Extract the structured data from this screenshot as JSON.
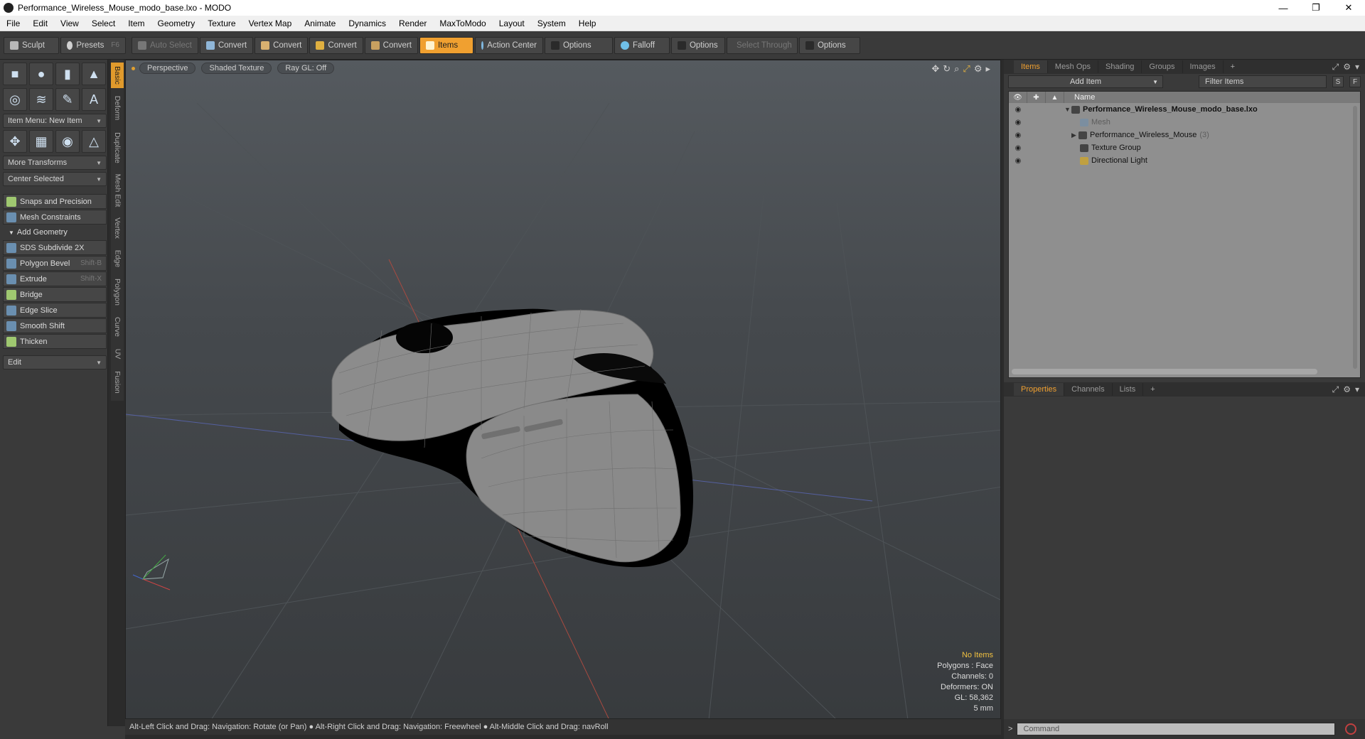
{
  "window": {
    "title": "Performance_Wireless_Mouse_modo_base.lxo - MODO",
    "minimize": "—",
    "maximize": "❐",
    "close": "✕"
  },
  "menu": [
    "File",
    "Edit",
    "View",
    "Select",
    "Item",
    "Geometry",
    "Texture",
    "Vertex Map",
    "Animate",
    "Dynamics",
    "Render",
    "MaxToModo",
    "Layout",
    "System",
    "Help"
  ],
  "toolbar": {
    "sculpt": "Sculpt",
    "presets": "Presets",
    "presets_shortcut": "F6",
    "auto_select": "Auto Select",
    "convert1": "Convert",
    "convert2": "Convert",
    "convert3": "Convert",
    "convert4": "Convert",
    "items": "Items",
    "action_center": "Action Center",
    "options1": "Options",
    "falloff": "Falloff",
    "options2": "Options",
    "select_through": "Select Through",
    "options3": "Options"
  },
  "left_panel": {
    "item_menu": "Item Menu: New Item",
    "more_transforms": "More Transforms",
    "center_selected": "Center Selected",
    "snaps": "Snaps and Precision",
    "mesh_constraints": "Mesh Constraints",
    "add_geometry": "Add Geometry",
    "tools": [
      {
        "label": "SDS Subdivide 2X",
        "shortcut": ""
      },
      {
        "label": "Polygon Bevel",
        "shortcut": "Shift-B"
      },
      {
        "label": "Extrude",
        "shortcut": "Shift-X"
      },
      {
        "label": "Bridge",
        "shortcut": ""
      },
      {
        "label": "Edge Slice",
        "shortcut": ""
      },
      {
        "label": "Smooth Shift",
        "shortcut": ""
      },
      {
        "label": "Thicken",
        "shortcut": ""
      }
    ],
    "edit": "Edit"
  },
  "vertical_tabs": [
    "Basic",
    "Deform",
    "Duplicate",
    "Mesh Edit",
    "Vertex",
    "Edge",
    "Polygon",
    "Curve",
    "UV",
    "Fusion"
  ],
  "viewport": {
    "view": "Perspective",
    "shading": "Shaded Texture",
    "raygl": "Ray GL: Off",
    "info": {
      "items": "No Items",
      "polygons": "Polygons : Face",
      "channels": "Channels: 0",
      "deformers": "Deformers: ON",
      "gl": "GL: 58,362",
      "scale": "5 mm"
    }
  },
  "status": "Alt-Left Click and Drag: Navigation: Rotate (or Pan) ● Alt-Right Click and Drag: Navigation: Freewheel ● Alt-Middle Click and Drag: navRoll",
  "right_panel": {
    "tabs": [
      "Items",
      "Mesh Ops",
      "Shading",
      "Groups",
      "Images"
    ],
    "add_item": "Add Item",
    "filter": "Filter Items",
    "s_btn": "S",
    "f_btn": "F",
    "name_col": "Name",
    "tree": [
      {
        "label": "Performance_Wireless_Mouse_modo_base.lxo",
        "count": ""
      },
      {
        "label": "Mesh",
        "count": ""
      },
      {
        "label": "Performance_Wireless_Mouse",
        "count": "(3)"
      },
      {
        "label": "Texture Group",
        "count": ""
      },
      {
        "label": "Directional Light",
        "count": ""
      }
    ],
    "prop_tabs": [
      "Properties",
      "Channels",
      "Lists"
    ],
    "command_placeholder": "Command"
  },
  "colors": {
    "accent": "#f0a030",
    "panel_bg": "#3a3a3a",
    "tree_bg": "#8f8f8f"
  }
}
